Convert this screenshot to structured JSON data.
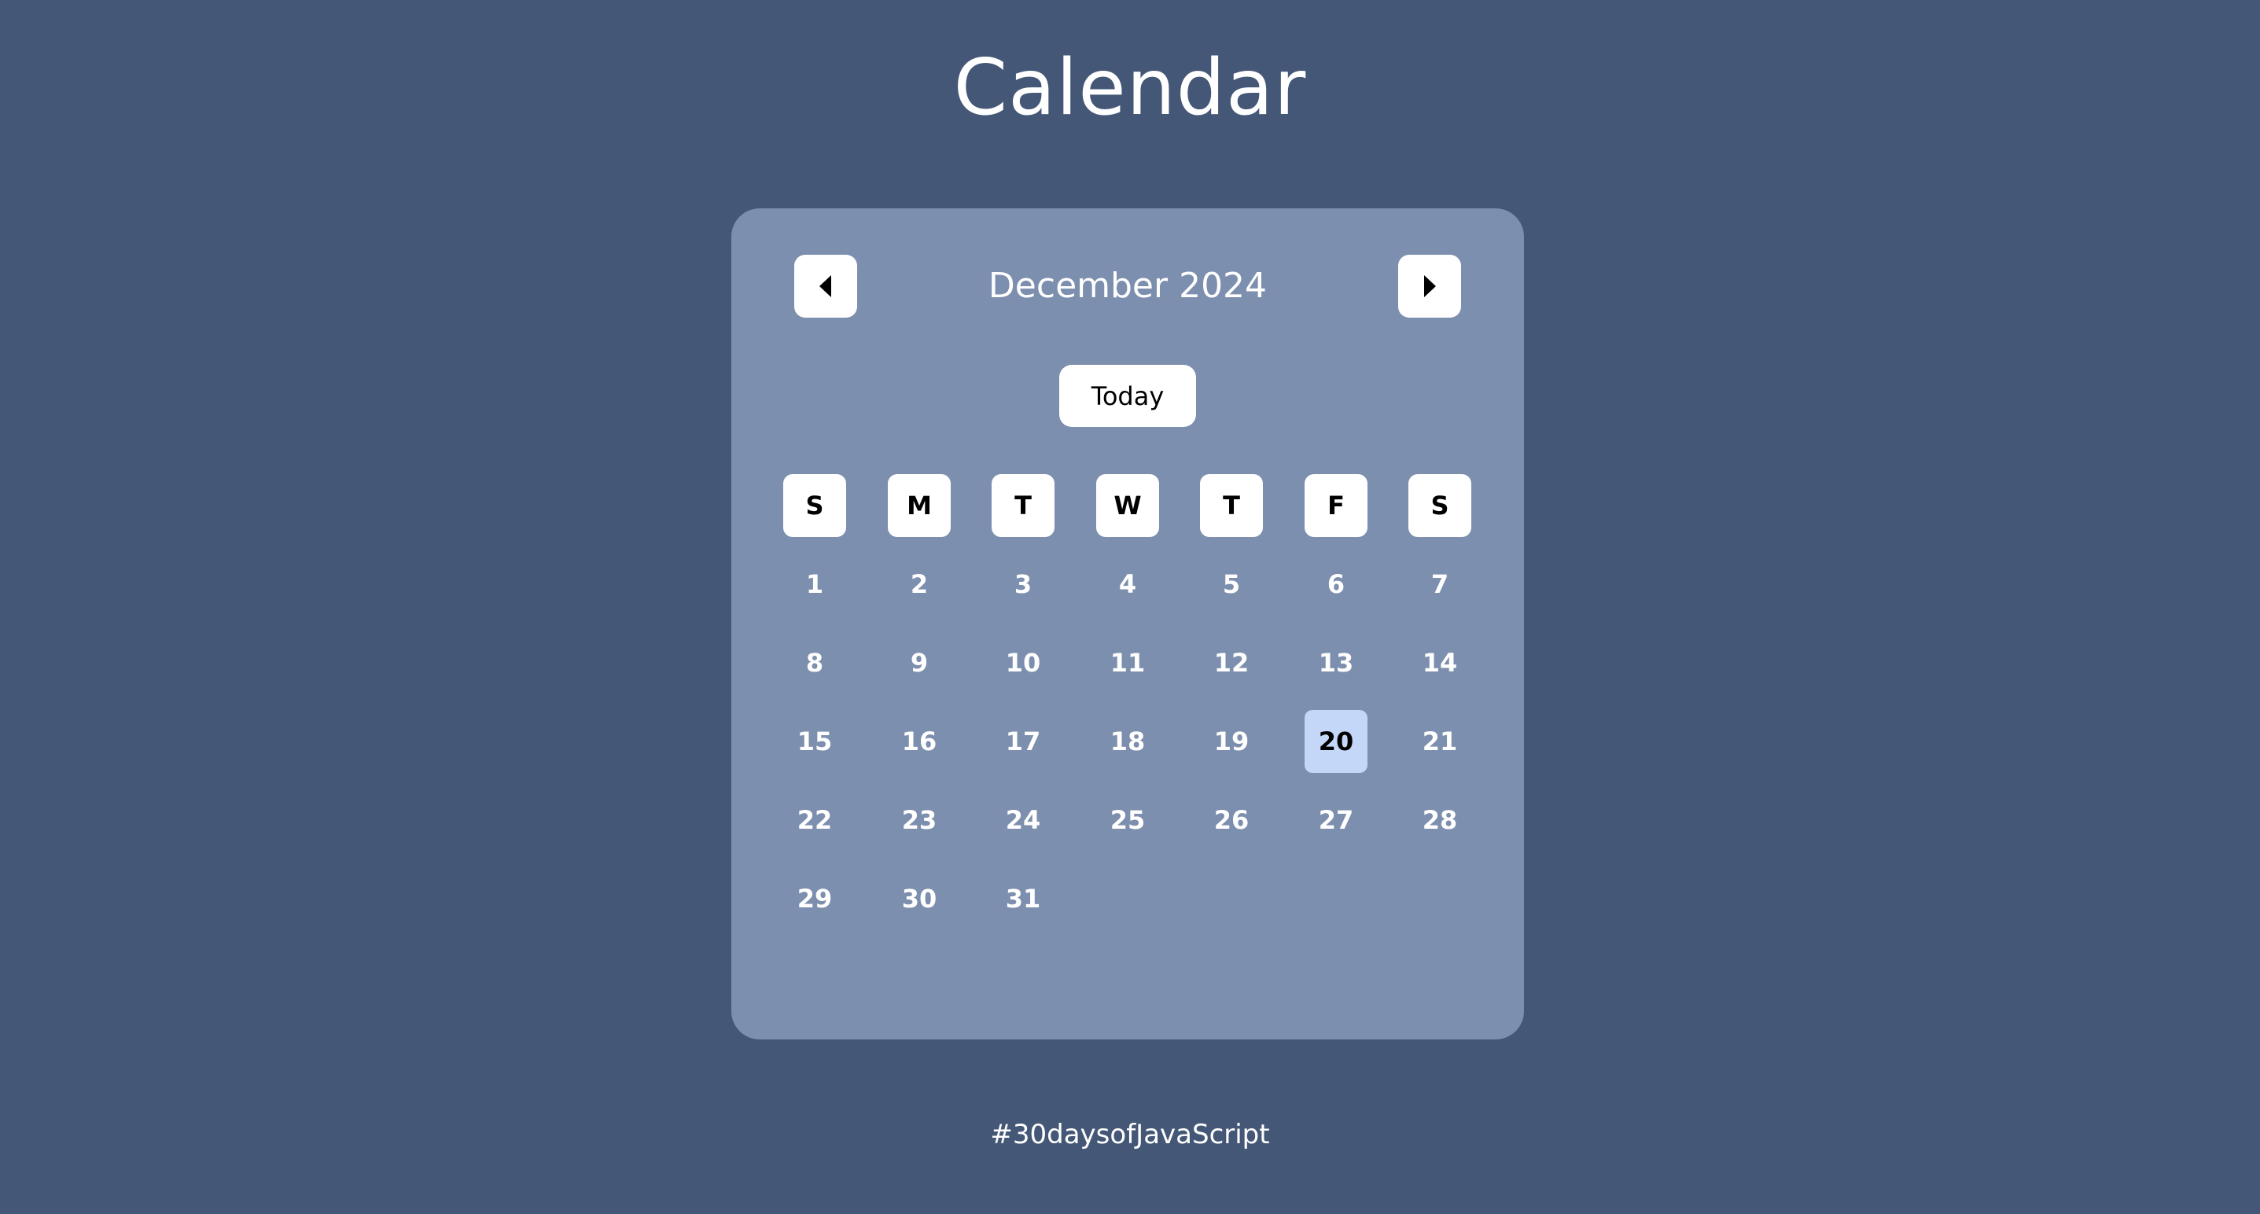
{
  "page": {
    "title": "Calendar",
    "footer": "#30daysofJavaScript"
  },
  "calendar": {
    "month_label": "December 2024",
    "today_label": "Today",
    "prev_icon": "caret-left-icon",
    "next_icon": "caret-right-icon",
    "weekdays": [
      "S",
      "M",
      "T",
      "W",
      "T",
      "F",
      "S"
    ],
    "weeks": [
      [
        "1",
        "2",
        "3",
        "4",
        "5",
        "6",
        "7"
      ],
      [
        "8",
        "9",
        "10",
        "11",
        "12",
        "13",
        "14"
      ],
      [
        "15",
        "16",
        "17",
        "18",
        "19",
        "20",
        "21"
      ],
      [
        "22",
        "23",
        "24",
        "25",
        "26",
        "27",
        "28"
      ],
      [
        "29",
        "30",
        "31",
        "",
        "",
        "",
        ""
      ]
    ],
    "selected_day": "20"
  },
  "colors": {
    "background": "#445776",
    "card": "#7d8fae",
    "selected_day": "#c5d7f8"
  }
}
